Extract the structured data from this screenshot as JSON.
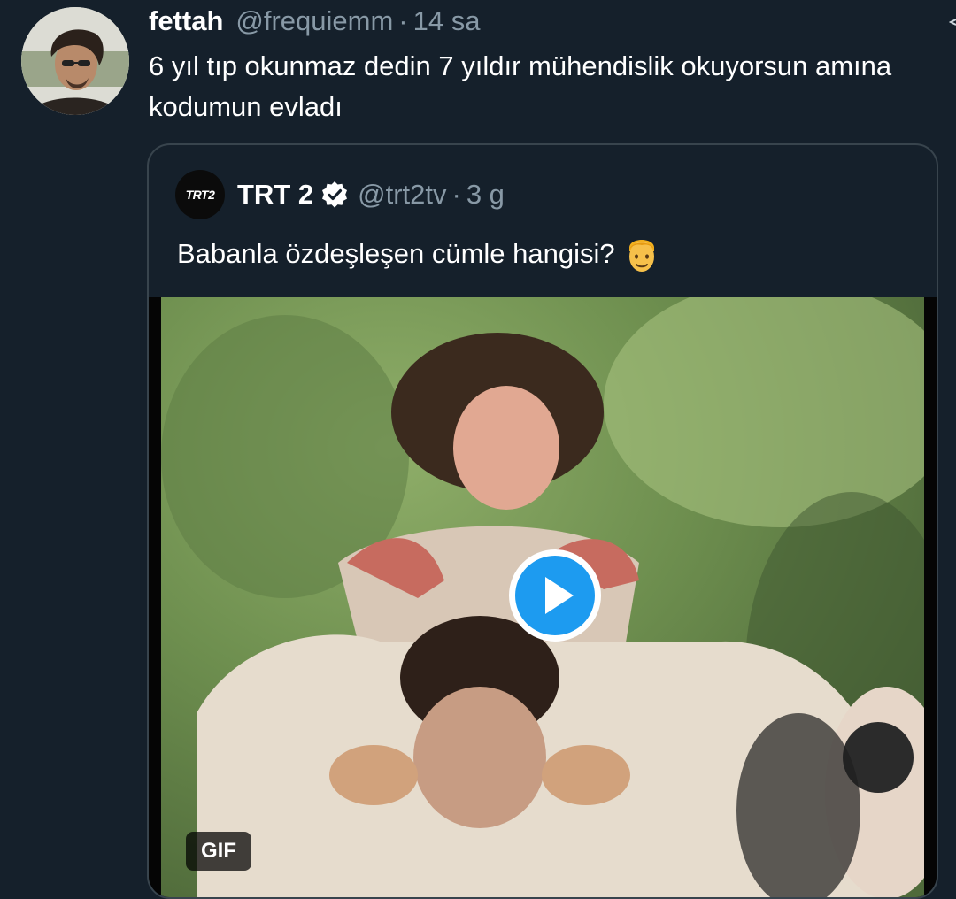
{
  "tweet": {
    "display_name": "fettah",
    "handle": "@frequiemm",
    "separator": "·",
    "time": "14 sa",
    "text": "6 yıl tıp okunmaz dedin 7 yıldır mühendislik okuyorsun amına kodumun evladı"
  },
  "quoted": {
    "avatar_label": "TRT2",
    "display_name": "TRT 2",
    "handle": "@trt2tv",
    "separator": "·",
    "time": "3 g",
    "text": "Babanla özdeşleşen cümle hangisi?",
    "emoji": "man-emoji",
    "media": {
      "badge": "GIF",
      "play_icon": "play-icon"
    }
  },
  "colors": {
    "background": "#15202b",
    "secondary_text": "#8899a6",
    "border": "#38444d",
    "accent": "#1d9bf0"
  }
}
